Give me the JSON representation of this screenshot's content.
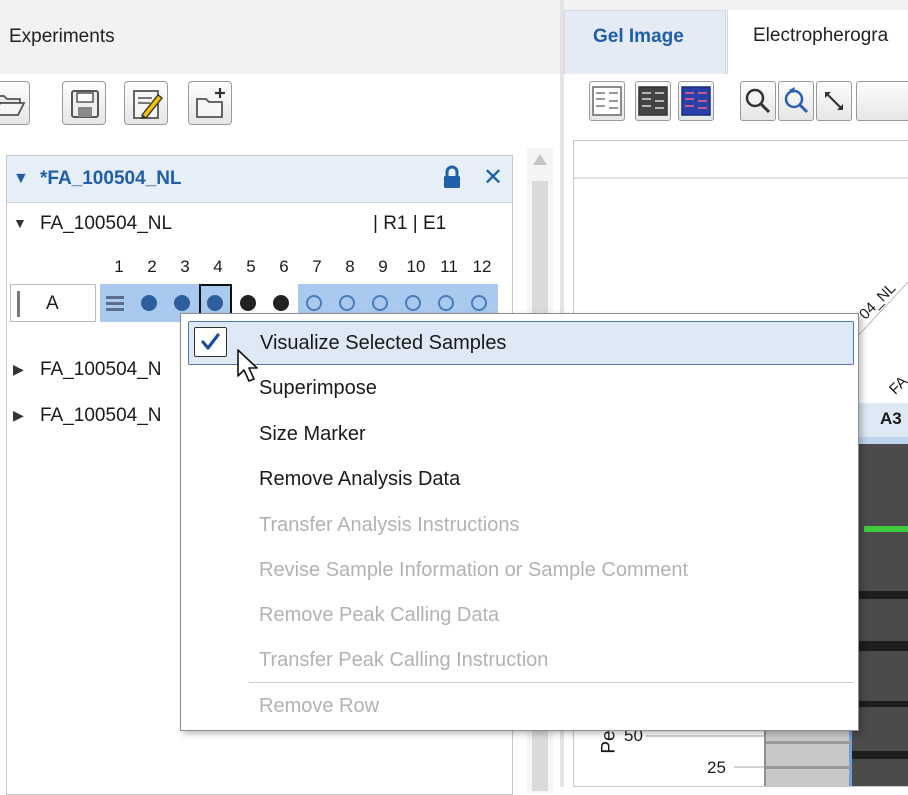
{
  "left_panel": {
    "title": "Experiments",
    "toolbar": {
      "open_icon": "folder-open-icon",
      "save_icon": "floppy-disk-icon",
      "edit_icon": "edit-document-icon",
      "new_icon": "new-folder-plus-icon"
    },
    "experiment": {
      "title": "*FA_100504_NL",
      "sub_item": {
        "label": "FA_100504_NL",
        "meta": "| R1 | E1"
      },
      "columns": [
        "1",
        "2",
        "3",
        "4",
        "5",
        "6",
        "7",
        "8",
        "9",
        "10",
        "11",
        "12"
      ],
      "row_label": "A",
      "other_items": [
        {
          "label": "FA_100504_N"
        },
        {
          "label": "FA_100504_N"
        }
      ]
    }
  },
  "right_panel": {
    "tabs": [
      {
        "label": "Gel Image",
        "active": true
      },
      {
        "label": "Electropherogra",
        "active": false
      }
    ],
    "gel": {
      "lane_label_1": "04_NL",
      "lane_label_2": "FA",
      "lane_id": "A3",
      "axis_label_fragment": "Pe",
      "tick_50": "50",
      "tick_25": "25"
    }
  },
  "context_menu": {
    "items": [
      {
        "label": "Visualize Selected Samples",
        "checked": true,
        "enabled": true
      },
      {
        "label": "Superimpose",
        "enabled": true
      },
      {
        "label": "Size Marker",
        "enabled": true
      },
      {
        "label": "Remove Analysis Data",
        "enabled": true
      },
      {
        "label": "Transfer Analysis Instructions",
        "enabled": false
      },
      {
        "label": "Revise Sample Information or Sample Comment",
        "enabled": false
      },
      {
        "label": "Remove Peak Calling Data",
        "enabled": false
      },
      {
        "label": "Transfer Peak Calling Instruction",
        "enabled": false
      },
      {
        "label": "Remove Row",
        "enabled": false
      }
    ]
  },
  "colors": {
    "accent_blue": "#1f5ea8",
    "well_selected_bg": "#a9c9ee",
    "menu_highlight": "#dfe8f5",
    "disabled_text": "#b2b2b2"
  }
}
